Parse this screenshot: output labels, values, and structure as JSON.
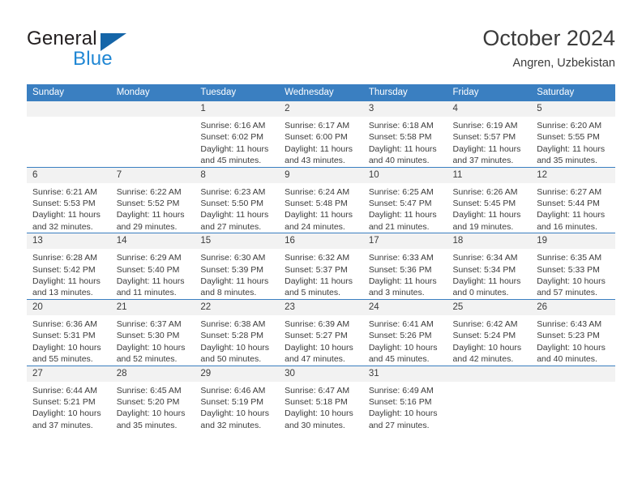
{
  "brand": {
    "name_top": "General",
    "name_bottom": "Blue",
    "triangle_color": "#1565a8",
    "blue_color": "#2087d4"
  },
  "header": {
    "title": "October 2024",
    "subtitle": "Angren, Uzbekistan"
  },
  "theme": {
    "header_blue": "#3a7fc1",
    "daynum_band": "#f2f2f2",
    "text": "#3b3b3b"
  },
  "calendar": {
    "weekday_headers": [
      "Sunday",
      "Monday",
      "Tuesday",
      "Wednesday",
      "Thursday",
      "Friday",
      "Saturday"
    ],
    "weeks": [
      [
        {
          "day": "",
          "blank": true
        },
        {
          "day": "",
          "blank": true
        },
        {
          "day": "1",
          "sunrise": "Sunrise: 6:16 AM",
          "sunset": "Sunset: 6:02 PM",
          "daylight1": "Daylight: 11 hours",
          "daylight2": "and 45 minutes."
        },
        {
          "day": "2",
          "sunrise": "Sunrise: 6:17 AM",
          "sunset": "Sunset: 6:00 PM",
          "daylight1": "Daylight: 11 hours",
          "daylight2": "and 43 minutes."
        },
        {
          "day": "3",
          "sunrise": "Sunrise: 6:18 AM",
          "sunset": "Sunset: 5:58 PM",
          "daylight1": "Daylight: 11 hours",
          "daylight2": "and 40 minutes."
        },
        {
          "day": "4",
          "sunrise": "Sunrise: 6:19 AM",
          "sunset": "Sunset: 5:57 PM",
          "daylight1": "Daylight: 11 hours",
          "daylight2": "and 37 minutes."
        },
        {
          "day": "5",
          "sunrise": "Sunrise: 6:20 AM",
          "sunset": "Sunset: 5:55 PM",
          "daylight1": "Daylight: 11 hours",
          "daylight2": "and 35 minutes."
        }
      ],
      [
        {
          "day": "6",
          "sunrise": "Sunrise: 6:21 AM",
          "sunset": "Sunset: 5:53 PM",
          "daylight1": "Daylight: 11 hours",
          "daylight2": "and 32 minutes."
        },
        {
          "day": "7",
          "sunrise": "Sunrise: 6:22 AM",
          "sunset": "Sunset: 5:52 PM",
          "daylight1": "Daylight: 11 hours",
          "daylight2": "and 29 minutes."
        },
        {
          "day": "8",
          "sunrise": "Sunrise: 6:23 AM",
          "sunset": "Sunset: 5:50 PM",
          "daylight1": "Daylight: 11 hours",
          "daylight2": "and 27 minutes."
        },
        {
          "day": "9",
          "sunrise": "Sunrise: 6:24 AM",
          "sunset": "Sunset: 5:48 PM",
          "daylight1": "Daylight: 11 hours",
          "daylight2": "and 24 minutes."
        },
        {
          "day": "10",
          "sunrise": "Sunrise: 6:25 AM",
          "sunset": "Sunset: 5:47 PM",
          "daylight1": "Daylight: 11 hours",
          "daylight2": "and 21 minutes."
        },
        {
          "day": "11",
          "sunrise": "Sunrise: 6:26 AM",
          "sunset": "Sunset: 5:45 PM",
          "daylight1": "Daylight: 11 hours",
          "daylight2": "and 19 minutes."
        },
        {
          "day": "12",
          "sunrise": "Sunrise: 6:27 AM",
          "sunset": "Sunset: 5:44 PM",
          "daylight1": "Daylight: 11 hours",
          "daylight2": "and 16 minutes."
        }
      ],
      [
        {
          "day": "13",
          "sunrise": "Sunrise: 6:28 AM",
          "sunset": "Sunset: 5:42 PM",
          "daylight1": "Daylight: 11 hours",
          "daylight2": "and 13 minutes."
        },
        {
          "day": "14",
          "sunrise": "Sunrise: 6:29 AM",
          "sunset": "Sunset: 5:40 PM",
          "daylight1": "Daylight: 11 hours",
          "daylight2": "and 11 minutes."
        },
        {
          "day": "15",
          "sunrise": "Sunrise: 6:30 AM",
          "sunset": "Sunset: 5:39 PM",
          "daylight1": "Daylight: 11 hours",
          "daylight2": "and 8 minutes."
        },
        {
          "day": "16",
          "sunrise": "Sunrise: 6:32 AM",
          "sunset": "Sunset: 5:37 PM",
          "daylight1": "Daylight: 11 hours",
          "daylight2": "and 5 minutes."
        },
        {
          "day": "17",
          "sunrise": "Sunrise: 6:33 AM",
          "sunset": "Sunset: 5:36 PM",
          "daylight1": "Daylight: 11 hours",
          "daylight2": "and 3 minutes."
        },
        {
          "day": "18",
          "sunrise": "Sunrise: 6:34 AM",
          "sunset": "Sunset: 5:34 PM",
          "daylight1": "Daylight: 11 hours",
          "daylight2": "and 0 minutes."
        },
        {
          "day": "19",
          "sunrise": "Sunrise: 6:35 AM",
          "sunset": "Sunset: 5:33 PM",
          "daylight1": "Daylight: 10 hours",
          "daylight2": "and 57 minutes."
        }
      ],
      [
        {
          "day": "20",
          "sunrise": "Sunrise: 6:36 AM",
          "sunset": "Sunset: 5:31 PM",
          "daylight1": "Daylight: 10 hours",
          "daylight2": "and 55 minutes."
        },
        {
          "day": "21",
          "sunrise": "Sunrise: 6:37 AM",
          "sunset": "Sunset: 5:30 PM",
          "daylight1": "Daylight: 10 hours",
          "daylight2": "and 52 minutes."
        },
        {
          "day": "22",
          "sunrise": "Sunrise: 6:38 AM",
          "sunset": "Sunset: 5:28 PM",
          "daylight1": "Daylight: 10 hours",
          "daylight2": "and 50 minutes."
        },
        {
          "day": "23",
          "sunrise": "Sunrise: 6:39 AM",
          "sunset": "Sunset: 5:27 PM",
          "daylight1": "Daylight: 10 hours",
          "daylight2": "and 47 minutes."
        },
        {
          "day": "24",
          "sunrise": "Sunrise: 6:41 AM",
          "sunset": "Sunset: 5:26 PM",
          "daylight1": "Daylight: 10 hours",
          "daylight2": "and 45 minutes."
        },
        {
          "day": "25",
          "sunrise": "Sunrise: 6:42 AM",
          "sunset": "Sunset: 5:24 PM",
          "daylight1": "Daylight: 10 hours",
          "daylight2": "and 42 minutes."
        },
        {
          "day": "26",
          "sunrise": "Sunrise: 6:43 AM",
          "sunset": "Sunset: 5:23 PM",
          "daylight1": "Daylight: 10 hours",
          "daylight2": "and 40 minutes."
        }
      ],
      [
        {
          "day": "27",
          "sunrise": "Sunrise: 6:44 AM",
          "sunset": "Sunset: 5:21 PM",
          "daylight1": "Daylight: 10 hours",
          "daylight2": "and 37 minutes."
        },
        {
          "day": "28",
          "sunrise": "Sunrise: 6:45 AM",
          "sunset": "Sunset: 5:20 PM",
          "daylight1": "Daylight: 10 hours",
          "daylight2": "and 35 minutes."
        },
        {
          "day": "29",
          "sunrise": "Sunrise: 6:46 AM",
          "sunset": "Sunset: 5:19 PM",
          "daylight1": "Daylight: 10 hours",
          "daylight2": "and 32 minutes."
        },
        {
          "day": "30",
          "sunrise": "Sunrise: 6:47 AM",
          "sunset": "Sunset: 5:18 PM",
          "daylight1": "Daylight: 10 hours",
          "daylight2": "and 30 minutes."
        },
        {
          "day": "31",
          "sunrise": "Sunrise: 6:49 AM",
          "sunset": "Sunset: 5:16 PM",
          "daylight1": "Daylight: 10 hours",
          "daylight2": "and 27 minutes."
        },
        {
          "day": "",
          "blank": true
        },
        {
          "day": "",
          "blank": true
        }
      ]
    ]
  }
}
